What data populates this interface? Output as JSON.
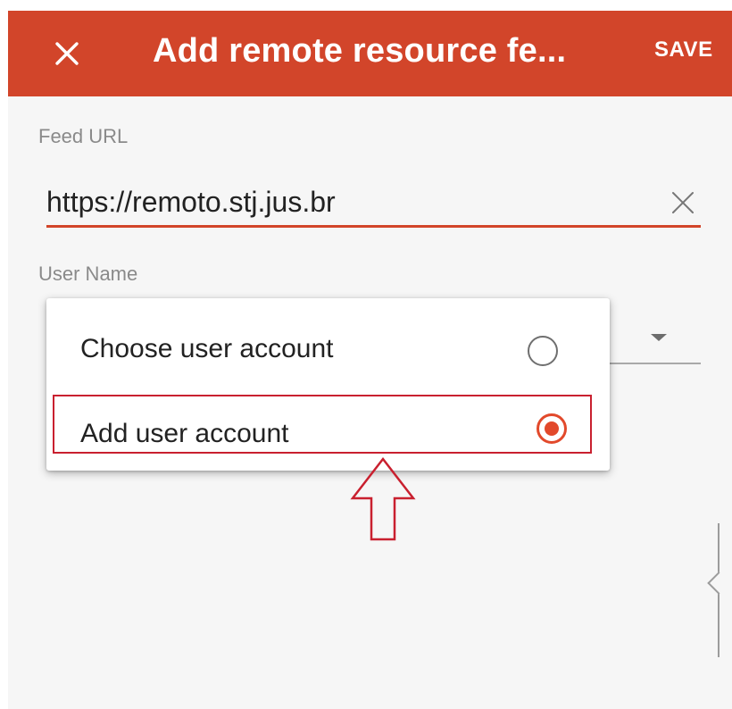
{
  "app_bar": {
    "title": "Add remote resource fe...",
    "save_label": "SAVE",
    "close_icon": "close-icon",
    "color": "#d2452a"
  },
  "feed_url": {
    "label": "Feed URL",
    "value": "https://remoto.stj.jus.br",
    "clear_icon": "clear-icon",
    "accent_color": "#d2452a"
  },
  "user_name": {
    "label": "User Name",
    "dropdown_icon": "dropdown-arrow-icon"
  },
  "account_menu": {
    "options": [
      {
        "label": "Choose user account",
        "selected": false
      },
      {
        "label": "Add user account",
        "selected": true
      }
    ],
    "radio_color": "#e2492b",
    "highlight_color": "#c9202f"
  },
  "annotation": {
    "arrow_icon": "up-arrow-icon"
  }
}
